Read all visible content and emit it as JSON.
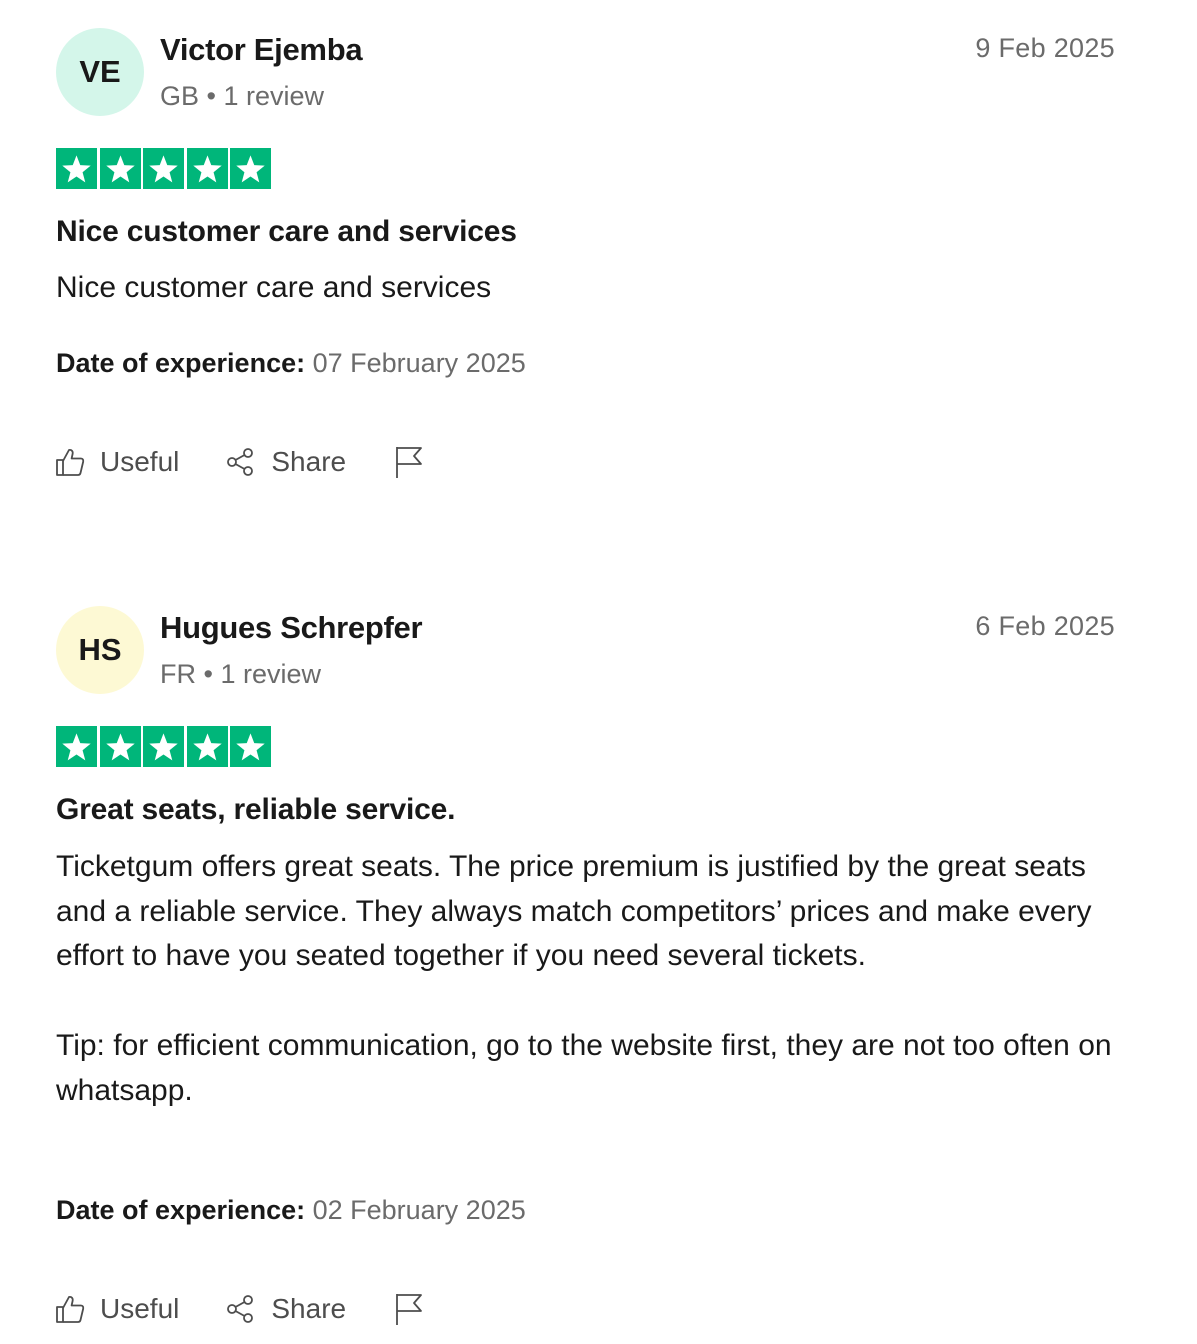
{
  "colors": {
    "star_bg": "#00b67a",
    "text": "#191919",
    "muted": "#6b6b6b"
  },
  "reviews": [
    {
      "initials": "VE",
      "avatar_color": "#d4f6ea",
      "name": "Victor Ejemba",
      "meta": "GB • 1 review",
      "date": "9 Feb 2025",
      "rating": 5,
      "title": "Nice customer care and services",
      "paragraphs": [
        "Nice customer care and services"
      ],
      "experience_label": "Date of experience:",
      "experience_date": "07 February 2025",
      "useful_label": "Useful",
      "share_label": "Share"
    },
    {
      "initials": "HS",
      "avatar_color": "#fdf9d4",
      "name": "Hugues Schrepfer",
      "meta": "FR • 1 review",
      "date": "6 Feb 2025",
      "rating": 5,
      "title": "Great seats, reliable service.",
      "paragraphs": [
        "Ticketgum offers great seats. The price premium is justified by the great seats and a reliable service. They always match competitors’ prices and make every effort to have you seated together if you need several tickets.",
        "Tip: for efficient communication, go to the website first, they are not too often on whatsapp."
      ],
      "experience_label": "Date of experience:",
      "experience_date": "02 February 2025",
      "useful_label": "Useful",
      "share_label": "Share"
    }
  ]
}
